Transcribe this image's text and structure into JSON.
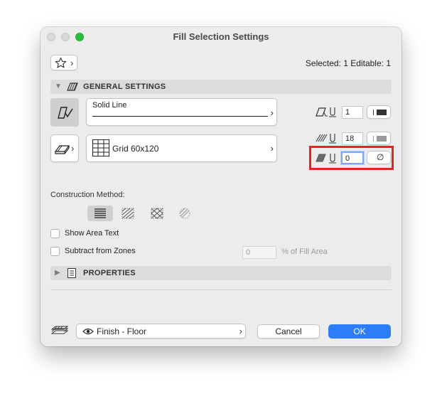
{
  "window": {
    "title": "Fill Selection Settings"
  },
  "header": {
    "selection_info": "Selected: 1 Editable: 1"
  },
  "general_settings": {
    "label": "GENERAL SETTINGS",
    "line_type": "Solid Line",
    "fill_type": "Grid 60x120",
    "contour_pen": "1",
    "foreground_pen": "18",
    "background_pen": "0",
    "background_value_symbol": "∅"
  },
  "construction": {
    "label": "Construction Method:",
    "methods": [
      "hatched",
      "gradient",
      "cross-hatch",
      "circular"
    ]
  },
  "options": {
    "show_area_text": "Show Area Text",
    "subtract_from_zones": "Subtract from Zones",
    "fill_area_value": "0",
    "fill_area_suffix": "% of Fill Area"
  },
  "properties": {
    "label": "PROPERTIES"
  },
  "footer": {
    "layer": "Finish - Floor",
    "cancel": "Cancel",
    "ok": "OK"
  },
  "colors": {
    "highlight": "#e8231d",
    "ok_blue": "#2c7df7"
  }
}
